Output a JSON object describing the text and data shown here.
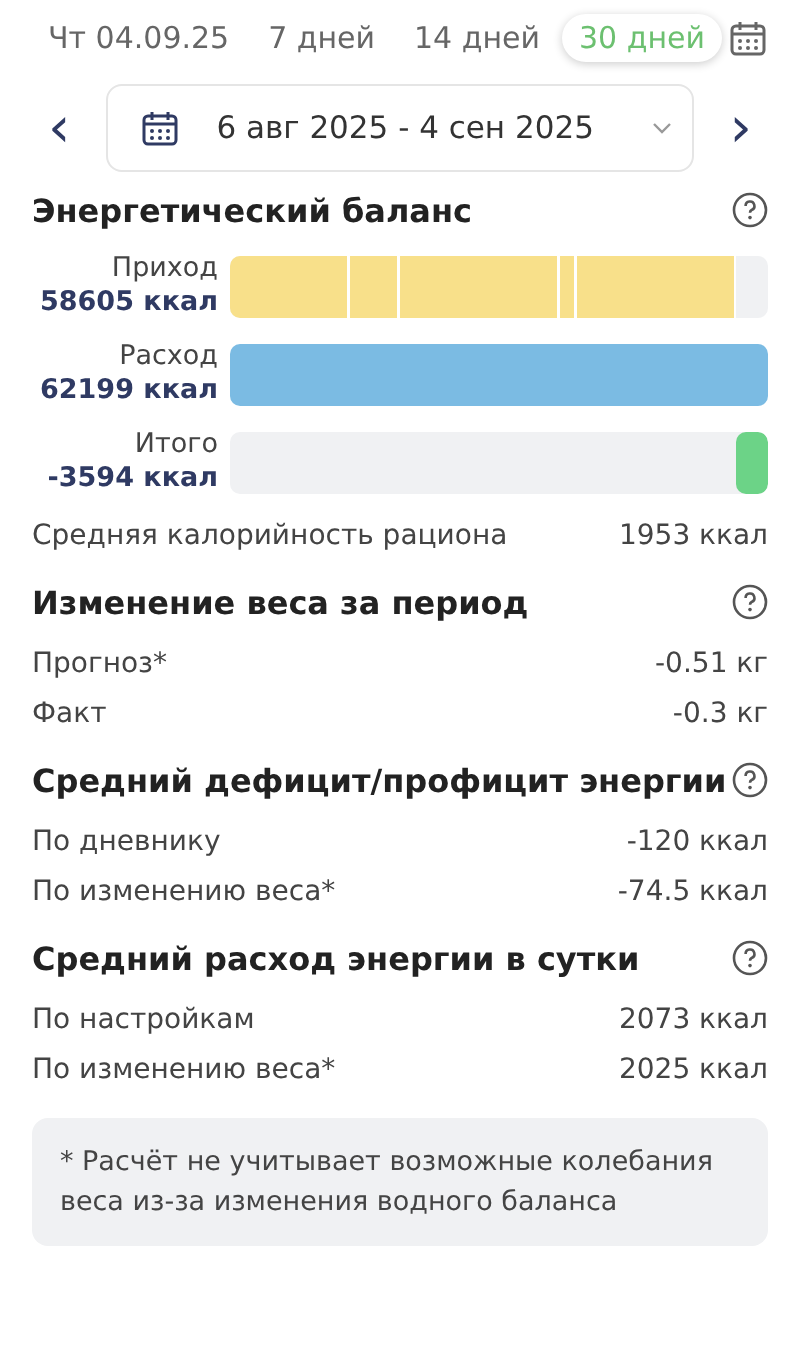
{
  "period_tabs": [
    {
      "label": "Чт 04.09.25",
      "selected": false
    },
    {
      "label": "7 дней",
      "selected": false
    },
    {
      "label": "14 дней",
      "selected": false
    },
    {
      "label": "30 дней",
      "selected": true
    }
  ],
  "date_range": {
    "prev": "‹",
    "value": "6 авг 2025 - 4 сен 2025",
    "next": "›"
  },
  "sections": [
    {
      "title": "Энергетический баланс",
      "bars": [
        {
          "kind": "segments",
          "label": "Приход",
          "value": "58605 ккал",
          "color": "#f8e08a",
          "level": 0.94
        },
        {
          "kind": "fill",
          "label": "Расход",
          "value": "62199 ккал",
          "color": "#7bbbe3",
          "level": 1
        },
        {
          "kind": "net",
          "label": "Итого",
          "value": "-3594 ккал",
          "color": "#6cd387",
          "level": 0.06
        }
      ],
      "rows": [
        {
          "label": "Средняя калорийность рациона",
          "value": "1953 ккал"
        }
      ]
    },
    {
      "title": "Изменение веса за период",
      "rows": [
        {
          "label": "Прогноз*",
          "value": "-0.51 кг"
        },
        {
          "label": "Факт",
          "value": "-0.3 кг"
        }
      ]
    },
    {
      "title": "Средний дефицит/профицит энергии",
      "rows": [
        {
          "label": "По дневнику",
          "value": "-120 ккал"
        },
        {
          "label": "По изменению веса*",
          "value": "-74.5 ккал"
        }
      ]
    },
    {
      "title": "Средний расход энергии в сутки",
      "rows": [
        {
          "label": "По настройкам",
          "value": "2073 ккал"
        },
        {
          "label": "По изменению веса*",
          "value": "2025 ккал"
        }
      ]
    }
  ],
  "footnote": "* Расчёт не учитывает возможные колебания веса из-за изменения водного баланса"
}
